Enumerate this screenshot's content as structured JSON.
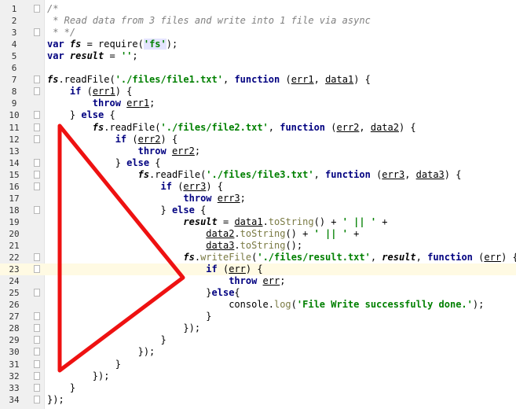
{
  "editor": {
    "lines": [
      {
        "no": "1",
        "fold": true,
        "tokens": [
          [
            "/*",
            "comment"
          ]
        ]
      },
      {
        "no": "2",
        "fold": false,
        "tokens": [
          [
            " * Read data from 3 files and write into 1 file via async",
            "comment"
          ]
        ]
      },
      {
        "no": "3",
        "fold": true,
        "tokens": [
          [
            " * */",
            "comment"
          ]
        ]
      },
      {
        "no": "4",
        "fold": false,
        "tokens": [
          [
            "var ",
            "keyword"
          ],
          [
            "fs",
            "var"
          ],
          [
            " = require(",
            "plain"
          ],
          [
            "'fs'",
            "string-hl"
          ],
          [
            ");",
            "plain"
          ]
        ]
      },
      {
        "no": "5",
        "fold": false,
        "tokens": [
          [
            "var ",
            "keyword"
          ],
          [
            "result",
            "var"
          ],
          [
            " = ",
            "plain"
          ],
          [
            "''",
            "string"
          ],
          [
            ";",
            "plain"
          ]
        ]
      },
      {
        "no": "6",
        "fold": false,
        "tokens": []
      },
      {
        "no": "7",
        "fold": true,
        "tokens": [
          [
            "fs",
            "var"
          ],
          [
            ".readFile(",
            "plain"
          ],
          [
            "'./files/file1.txt'",
            "string"
          ],
          [
            ", ",
            "plain"
          ],
          [
            "function ",
            "keyword"
          ],
          [
            "(",
            "plain"
          ],
          [
            "err1",
            "param"
          ],
          [
            ", ",
            "plain"
          ],
          [
            "data1",
            "param"
          ],
          [
            ") {",
            "plain"
          ]
        ]
      },
      {
        "no": "8",
        "fold": true,
        "tokens": [
          [
            "    ",
            "plain"
          ],
          [
            "if ",
            "keyword"
          ],
          [
            "(",
            "plain"
          ],
          [
            "err1",
            "param"
          ],
          [
            ") {",
            "plain"
          ]
        ]
      },
      {
        "no": "9",
        "fold": false,
        "tokens": [
          [
            "        ",
            "plain"
          ],
          [
            "throw ",
            "keyword"
          ],
          [
            "err1",
            "param"
          ],
          [
            ";",
            "plain"
          ]
        ]
      },
      {
        "no": "10",
        "fold": true,
        "tokens": [
          [
            "    } ",
            "plain"
          ],
          [
            "else ",
            "keyword"
          ],
          [
            "{",
            "plain"
          ]
        ]
      },
      {
        "no": "11",
        "fold": true,
        "tokens": [
          [
            "        ",
            "plain"
          ],
          [
            "fs",
            "var"
          ],
          [
            ".readFile(",
            "plain"
          ],
          [
            "'./files/file2.txt'",
            "string"
          ],
          [
            ", ",
            "plain"
          ],
          [
            "function ",
            "keyword"
          ],
          [
            "(",
            "plain"
          ],
          [
            "err2",
            "param"
          ],
          [
            ", ",
            "plain"
          ],
          [
            "data2",
            "param"
          ],
          [
            ") {",
            "plain"
          ]
        ]
      },
      {
        "no": "12",
        "fold": true,
        "tokens": [
          [
            "            ",
            "plain"
          ],
          [
            "if ",
            "keyword"
          ],
          [
            "(",
            "plain"
          ],
          [
            "err2",
            "param"
          ],
          [
            ") {",
            "plain"
          ]
        ]
      },
      {
        "no": "13",
        "fold": false,
        "tokens": [
          [
            "                ",
            "plain"
          ],
          [
            "throw ",
            "keyword"
          ],
          [
            "err2",
            "param"
          ],
          [
            ";",
            "plain"
          ]
        ]
      },
      {
        "no": "14",
        "fold": true,
        "tokens": [
          [
            "            } ",
            "plain"
          ],
          [
            "else ",
            "keyword"
          ],
          [
            "{",
            "plain"
          ]
        ]
      },
      {
        "no": "15",
        "fold": true,
        "tokens": [
          [
            "                ",
            "plain"
          ],
          [
            "fs",
            "var"
          ],
          [
            ".readFile(",
            "plain"
          ],
          [
            "'./files/file3.txt'",
            "string"
          ],
          [
            ", ",
            "plain"
          ],
          [
            "function ",
            "keyword"
          ],
          [
            "(",
            "plain"
          ],
          [
            "err3",
            "param"
          ],
          [
            ", ",
            "plain"
          ],
          [
            "data3",
            "param"
          ],
          [
            ") {",
            "plain"
          ]
        ]
      },
      {
        "no": "16",
        "fold": true,
        "tokens": [
          [
            "                    ",
            "plain"
          ],
          [
            "if ",
            "keyword"
          ],
          [
            "(",
            "plain"
          ],
          [
            "err3",
            "param"
          ],
          [
            ") {",
            "plain"
          ]
        ]
      },
      {
        "no": "17",
        "fold": false,
        "tokens": [
          [
            "                        ",
            "plain"
          ],
          [
            "throw ",
            "keyword"
          ],
          [
            "err3",
            "param"
          ],
          [
            ";",
            "plain"
          ]
        ]
      },
      {
        "no": "18",
        "fold": true,
        "tokens": [
          [
            "                    } ",
            "plain"
          ],
          [
            "else ",
            "keyword"
          ],
          [
            "{",
            "plain"
          ]
        ]
      },
      {
        "no": "19",
        "fold": false,
        "tokens": [
          [
            "                        ",
            "plain"
          ],
          [
            "result",
            "var"
          ],
          [
            " = ",
            "plain"
          ],
          [
            "data1",
            "param"
          ],
          [
            ".",
            "plain"
          ],
          [
            "toString",
            "method"
          ],
          [
            "() + ",
            "plain"
          ],
          [
            "' || '",
            "string"
          ],
          [
            " +",
            "plain"
          ]
        ]
      },
      {
        "no": "20",
        "fold": false,
        "tokens": [
          [
            "                            ",
            "plain"
          ],
          [
            "data2",
            "param"
          ],
          [
            ".",
            "plain"
          ],
          [
            "toString",
            "method"
          ],
          [
            "() + ",
            "plain"
          ],
          [
            "' || '",
            "string"
          ],
          [
            " +",
            "plain"
          ]
        ]
      },
      {
        "no": "21",
        "fold": false,
        "tokens": [
          [
            "                            ",
            "plain"
          ],
          [
            "data3",
            "param"
          ],
          [
            ".",
            "plain"
          ],
          [
            "toString",
            "method"
          ],
          [
            "();",
            "plain"
          ]
        ]
      },
      {
        "no": "22",
        "fold": true,
        "tokens": [
          [
            "                        ",
            "plain"
          ],
          [
            "fs",
            "var"
          ],
          [
            ".",
            "plain"
          ],
          [
            "writeFile",
            "method"
          ],
          [
            "(",
            "plain"
          ],
          [
            "'./files/result.txt'",
            "string"
          ],
          [
            ", ",
            "plain"
          ],
          [
            "result",
            "var"
          ],
          [
            ", ",
            "plain"
          ],
          [
            "function ",
            "keyword"
          ],
          [
            "(",
            "plain"
          ],
          [
            "err",
            "param"
          ],
          [
            ") {",
            "plain"
          ]
        ]
      },
      {
        "no": "23",
        "fold": true,
        "current": true,
        "tokens": [
          [
            "                            ",
            "plain"
          ],
          [
            "if ",
            "keyword"
          ],
          [
            "(",
            "plain"
          ],
          [
            "err",
            "param"
          ],
          [
            ") {",
            "plain"
          ]
        ]
      },
      {
        "no": "24",
        "fold": false,
        "tokens": [
          [
            "                                ",
            "plain"
          ],
          [
            "throw ",
            "keyword"
          ],
          [
            "err",
            "param"
          ],
          [
            ";",
            "plain"
          ]
        ]
      },
      {
        "no": "25",
        "fold": true,
        "tokens": [
          [
            "                            }",
            "plain"
          ],
          [
            "else",
            "keyword"
          ],
          [
            "{",
            "plain"
          ]
        ]
      },
      {
        "no": "26",
        "fold": false,
        "tokens": [
          [
            "                                console.",
            "plain"
          ],
          [
            "log",
            "method"
          ],
          [
            "(",
            "plain"
          ],
          [
            "'File Write successfully done.'",
            "string"
          ],
          [
            ");",
            "plain"
          ]
        ]
      },
      {
        "no": "27",
        "fold": true,
        "tokens": [
          [
            "                            }",
            "plain"
          ]
        ]
      },
      {
        "no": "28",
        "fold": true,
        "tokens": [
          [
            "                        });",
            "plain"
          ]
        ]
      },
      {
        "no": "29",
        "fold": true,
        "tokens": [
          [
            "                    }",
            "plain"
          ]
        ]
      },
      {
        "no": "30",
        "fold": true,
        "tokens": [
          [
            "                });",
            "plain"
          ]
        ]
      },
      {
        "no": "31",
        "fold": true,
        "tokens": [
          [
            "            }",
            "plain"
          ]
        ]
      },
      {
        "no": "32",
        "fold": true,
        "tokens": [
          [
            "        });",
            "plain"
          ]
        ]
      },
      {
        "no": "33",
        "fold": true,
        "tokens": [
          [
            "    }",
            "plain"
          ]
        ]
      },
      {
        "no": "34",
        "fold": true,
        "tokens": [
          [
            "});",
            "plain"
          ]
        ]
      }
    ]
  },
  "annotation": {
    "shape": "red-triangle-callback-pyramid",
    "color": "#ee1111"
  }
}
